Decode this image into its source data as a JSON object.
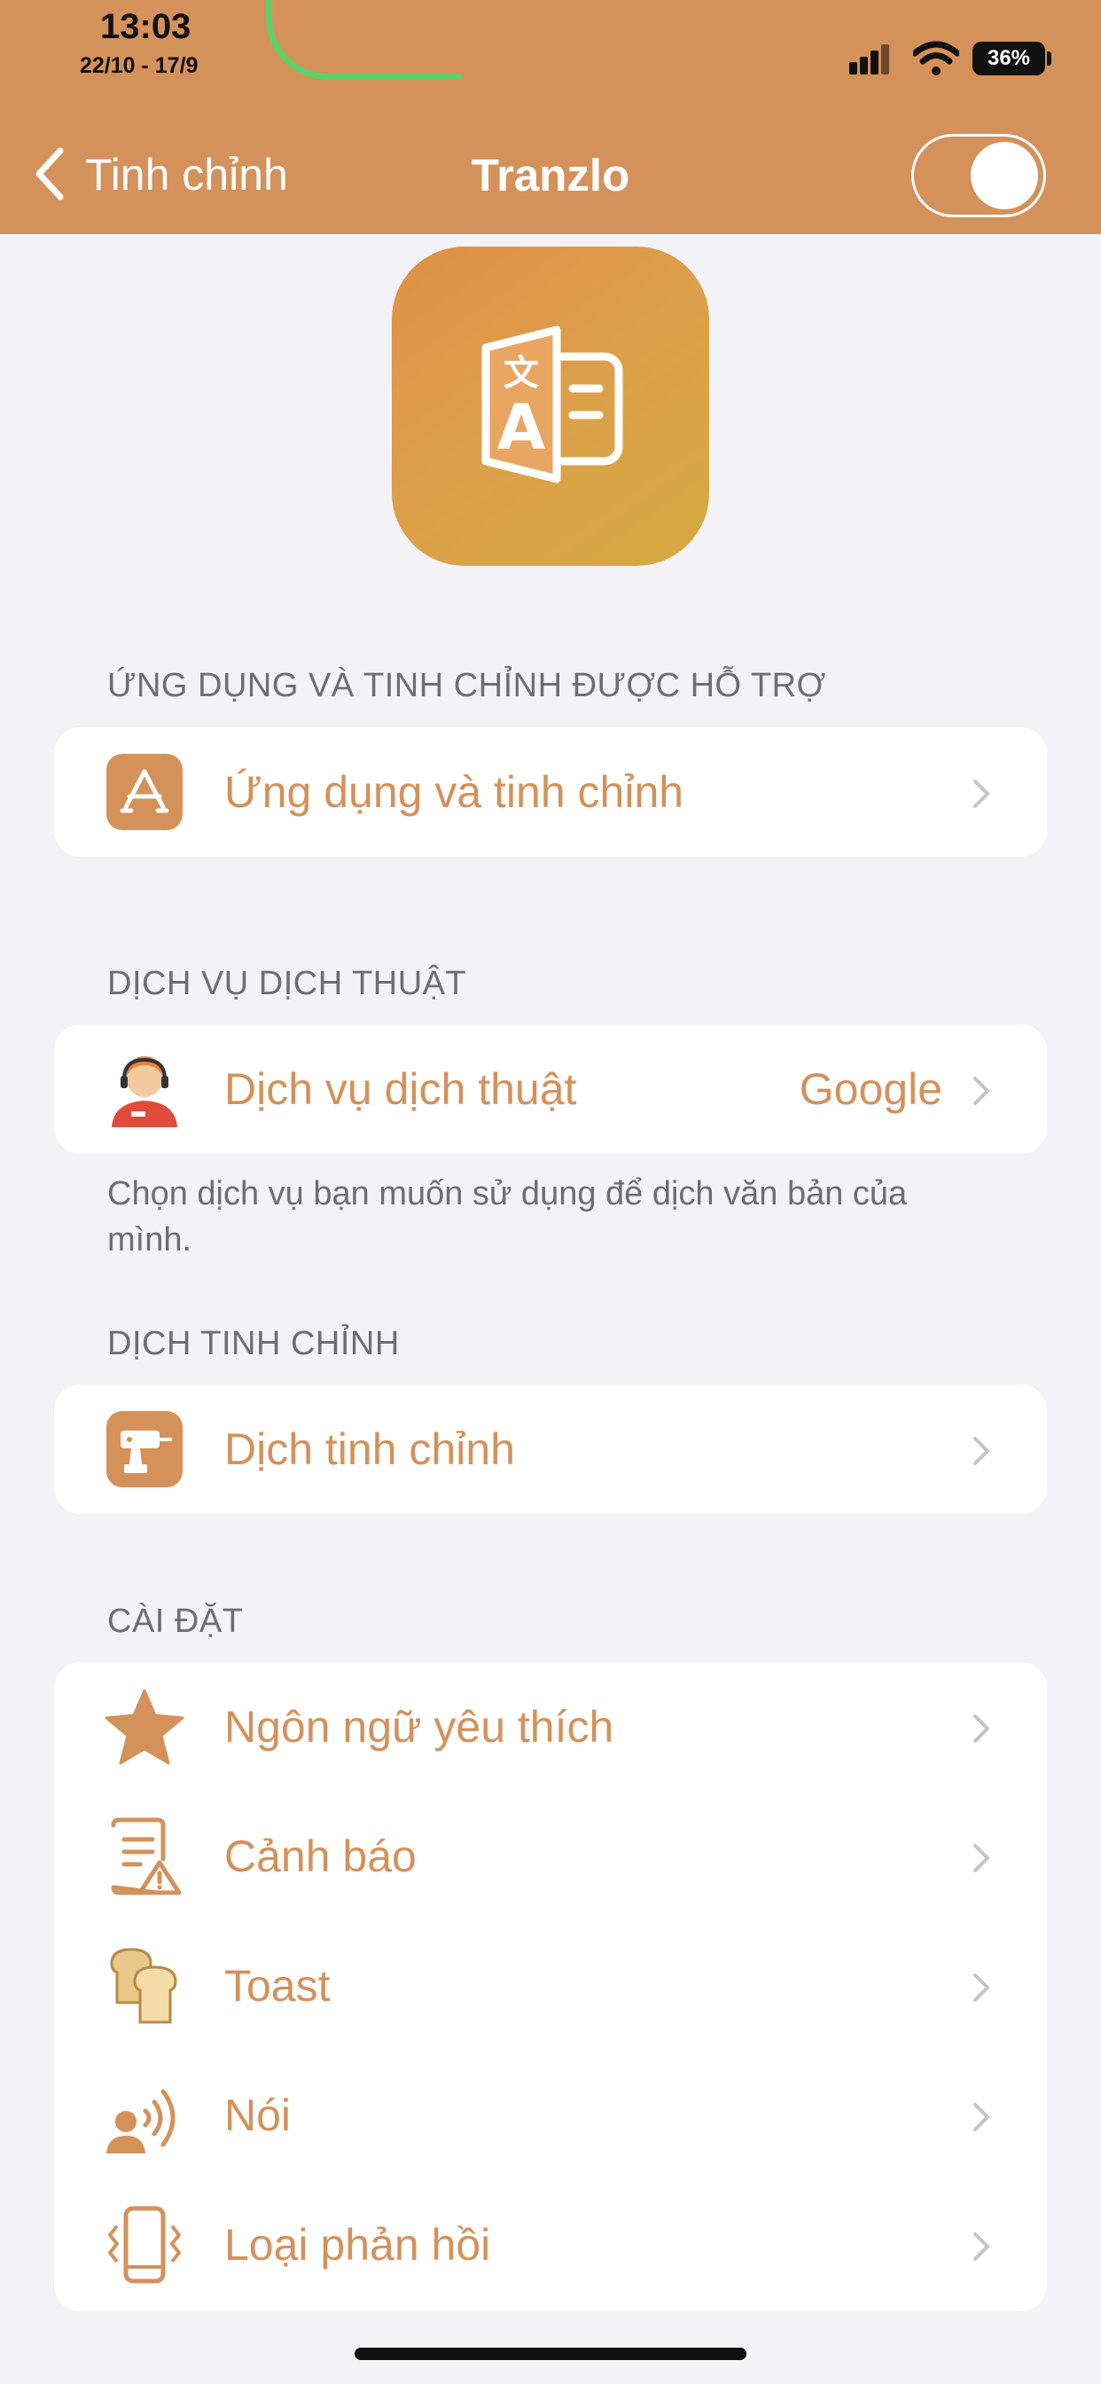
{
  "status_bar": {
    "time": "13:03",
    "date": "22/10 - 17/9",
    "battery": "36%"
  },
  "nav": {
    "back_label": "Tinh chỉnh",
    "title": "Tranzlo",
    "toggle_on": true
  },
  "sections": {
    "supported": {
      "header": "ỨNG DỤNG VÀ TINH CHỈNH ĐƯỢC HỖ TRỢ",
      "items": [
        {
          "label": "Ứng dụng và tinh chỉnh",
          "icon": "app-store-icon"
        }
      ]
    },
    "translation_service": {
      "header": "DỊCH VỤ DỊCH THUẬT",
      "items": [
        {
          "label": "Dịch vụ dịch thuật",
          "value": "Google",
          "icon": "translator-person-icon"
        }
      ],
      "footer": "Chọn dịch vụ bạn muốn sử dụng để dịch văn bản của mình."
    },
    "translate_tweak": {
      "header": "DỊCH TINH CHỈNH",
      "items": [
        {
          "label": "Dịch tinh chỉnh",
          "icon": "drill-icon"
        }
      ]
    },
    "settings": {
      "header": "CÀI ĐẶT",
      "items": [
        {
          "label": "Ngôn ngữ yêu thích",
          "icon": "star-icon"
        },
        {
          "label": "Cảnh báo",
          "icon": "alert-document-icon"
        },
        {
          "label": "Toast",
          "icon": "toast-bread-icon"
        },
        {
          "label": "Nói",
          "icon": "speaking-person-icon"
        },
        {
          "label": "Loại phản hồi",
          "icon": "vibrating-phone-icon"
        }
      ]
    }
  },
  "colors": {
    "accent": "#d4915a",
    "background": "#f2f2f7",
    "card": "#ffffff",
    "secondary_text": "#6d6d72"
  }
}
